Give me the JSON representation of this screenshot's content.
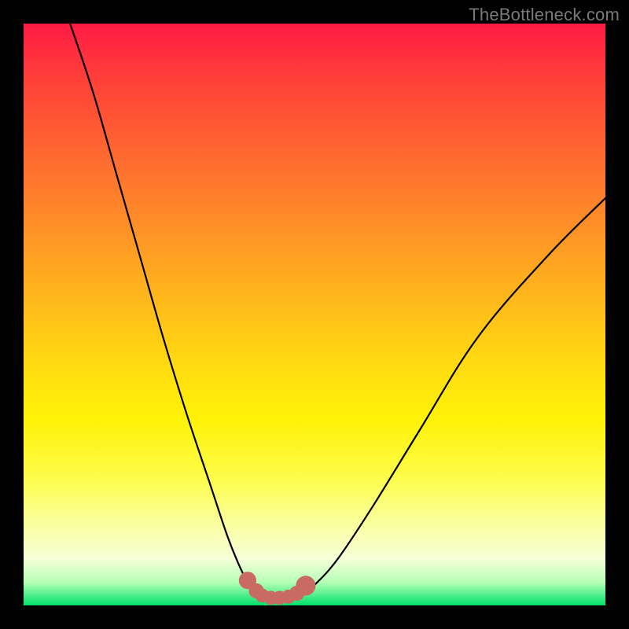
{
  "watermark": "TheBottleneck.com",
  "colors": {
    "page_bg": "#000000",
    "curve_stroke": "#000000",
    "marker_fill": "#c96a63",
    "gradient_top": "#ff1a44",
    "gradient_bottom": "#00e26a"
  },
  "chart_data": {
    "type": "line",
    "title": "",
    "xlabel": "",
    "ylabel": "",
    "xlim": [
      0,
      100
    ],
    "ylim": [
      0,
      100
    ],
    "grid": false,
    "legend": false,
    "note": "No axis labels or tick marks are rendered in the image; values are normalized 0–100 estimates from pixel positions.",
    "series": [
      {
        "name": "curve",
        "x": [
          8,
          12,
          16,
          20,
          24,
          28,
          32,
          35,
          37,
          38.5,
          40,
          42,
          44,
          46,
          48,
          50,
          54,
          60,
          68,
          78,
          90,
          100
        ],
        "y": [
          100,
          88,
          74,
          60,
          46,
          33,
          21,
          12,
          7,
          4,
          2,
          1,
          1,
          1.3,
          2,
          3.5,
          8,
          17,
          30,
          46,
          60,
          70
        ]
      }
    ],
    "markers": {
      "name": "bottom-cluster",
      "x": [
        38.5,
        40,
        41,
        42.5,
        44,
        45.5,
        47,
        48.5
      ],
      "y": [
        4.3,
        2.5,
        1.7,
        1.3,
        1.3,
        1.5,
        2.1,
        3.4
      ],
      "r": [
        1.5,
        1.3,
        1.2,
        1.2,
        1.2,
        1.2,
        1.3,
        1.7
      ]
    }
  }
}
